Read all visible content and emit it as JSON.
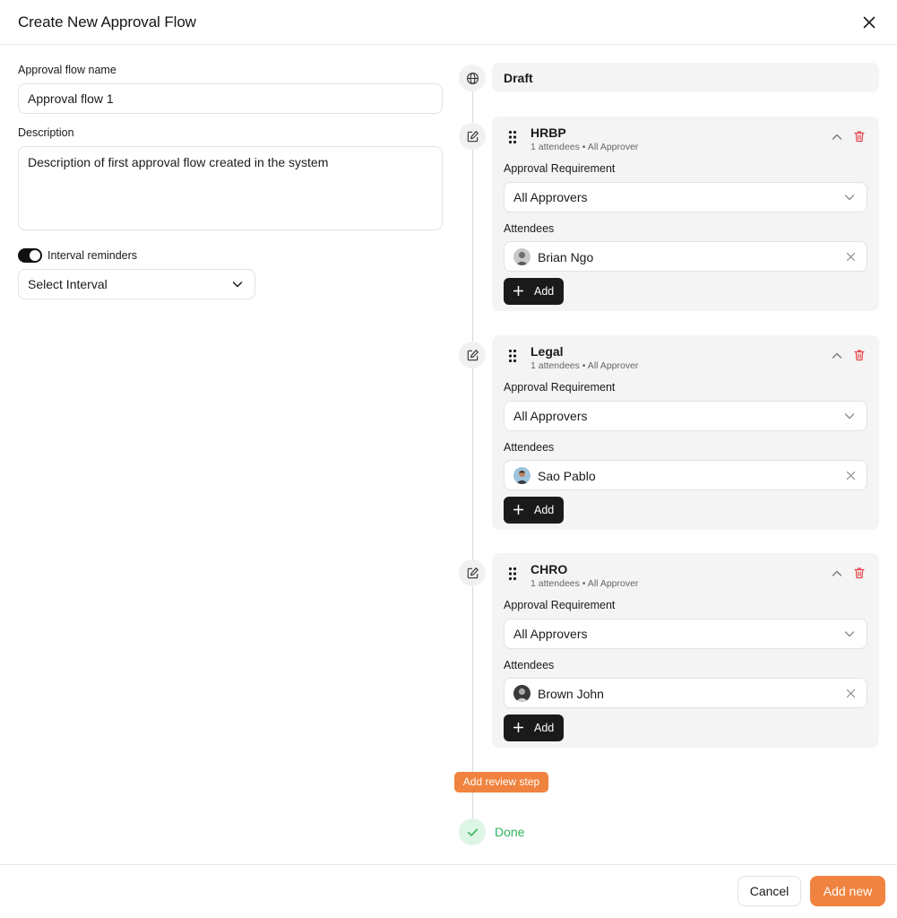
{
  "dialog": {
    "title": "Create New Approval Flow"
  },
  "form": {
    "name_label": "Approval flow name",
    "name_value": "Approval flow 1",
    "description_label": "Description",
    "description_value": "Description of first approval flow created in the system",
    "interval_reminders_label": "Interval reminders",
    "interval_reminders_enabled": true,
    "interval_select_value": "Select Interval"
  },
  "timeline": {
    "draft_label": "Draft",
    "steps": [
      {
        "title": "HRBP",
        "subtitle": "1 attendees • All Approver",
        "requirement_label": "Approval Requirement",
        "requirement_value": "All Approvers",
        "attendees_label": "Attendees",
        "attendee": "Brian Ngo",
        "add_label": "Add"
      },
      {
        "title": "Legal",
        "subtitle": "1 attendees • All Approver",
        "requirement_label": "Approval Requirement",
        "requirement_value": "All Approvers",
        "attendees_label": "Attendees",
        "attendee": "Sao Pablo",
        "add_label": "Add"
      },
      {
        "title": "CHRO",
        "subtitle": "1 attendees • All Approver",
        "requirement_label": "Approval Requirement",
        "requirement_value": "All Approvers",
        "attendees_label": "Attendees",
        "attendee": "Brown John",
        "add_label": "Add"
      }
    ],
    "add_review_step_label": "Add review step",
    "done_label": "Done"
  },
  "footer": {
    "cancel_label": "Cancel",
    "add_new_label": "Add new"
  },
  "colors": {
    "accent": "#f0833f",
    "done": "#2fb45a",
    "delete": "#e5484d",
    "dark_button": "#1a1a1a",
    "card_bg": "#f4f4f4"
  },
  "icons": {
    "close": "close-icon",
    "globe": "globe-icon",
    "edit": "edit-icon",
    "drag": "drag-handle-icon",
    "chevron_up": "chevron-up-icon",
    "chevron_down": "chevron-down-icon",
    "trash": "trash-icon",
    "remove": "x-icon",
    "plus": "plus-icon",
    "check": "check-icon"
  }
}
